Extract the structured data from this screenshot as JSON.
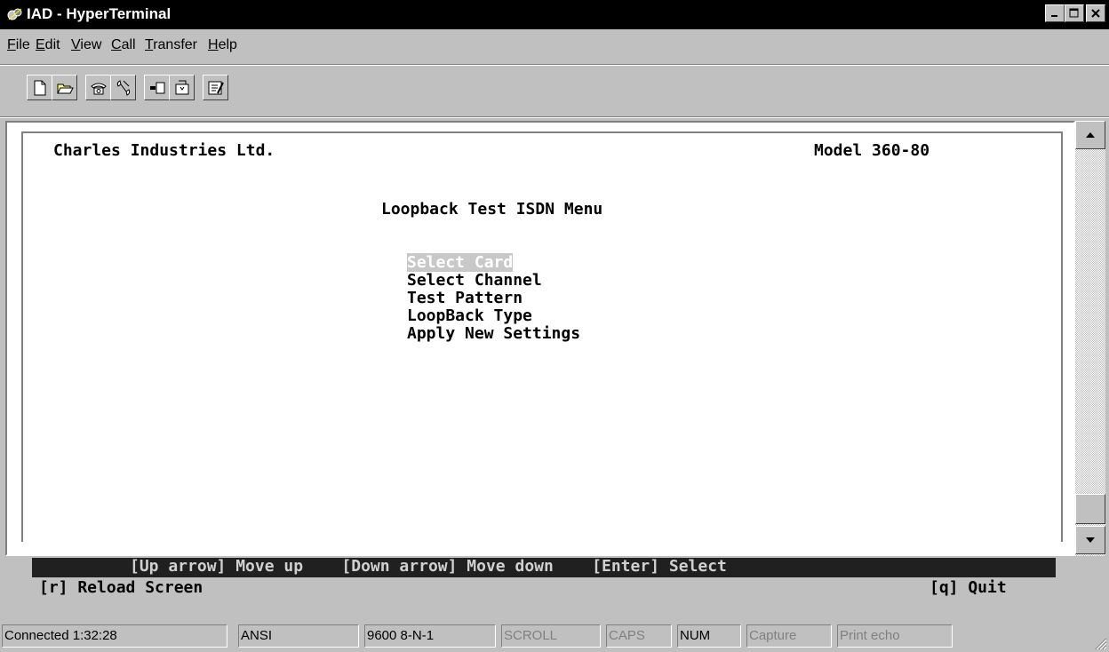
{
  "window": {
    "title": "IAD - HyperTerminal",
    "controls": [
      "minimize-icon",
      "maximize-icon",
      "close-icon"
    ]
  },
  "menu": {
    "items": [
      {
        "label": "File",
        "accel": "F",
        "rest": "ile"
      },
      {
        "label": "Edit",
        "accel": "E",
        "rest": "dit"
      },
      {
        "label": "View",
        "accel": "V",
        "rest": "iew"
      },
      {
        "label": "Call",
        "accel": "C",
        "rest": "all"
      },
      {
        "label": "Transfer",
        "accel": "T",
        "rest": "ransfer"
      },
      {
        "label": "Help",
        "accel": "H",
        "rest": "elp"
      }
    ]
  },
  "toolbar": {
    "buttons": [
      "new-icon",
      "open-icon",
      "connect-icon",
      "disconnect-icon",
      "send-icon",
      "receive-icon",
      "properties-icon"
    ]
  },
  "terminal": {
    "company": "Charles Industries Ltd.",
    "model": "Model 360-80",
    "menu_title": "Loopback Test ISDN Menu",
    "options": [
      "Select Card",
      "Select Channel",
      "Test Pattern",
      "LoopBack Type",
      "Apply New Settings"
    ],
    "selected_index": 0,
    "help_line": "[Up arrow] Move up    [Down arrow] Move down    [Enter] Select",
    "reload": "[r] Reload Screen",
    "quit": "[q] Quit"
  },
  "status": {
    "connected": "Connected 1:32:28",
    "emulation": "ANSI",
    "port_settings": "9600 8-N-1",
    "scroll": "SCROLL",
    "caps": "CAPS",
    "num": "NUM",
    "capture": "Capture",
    "print_echo": "Print echo"
  }
}
